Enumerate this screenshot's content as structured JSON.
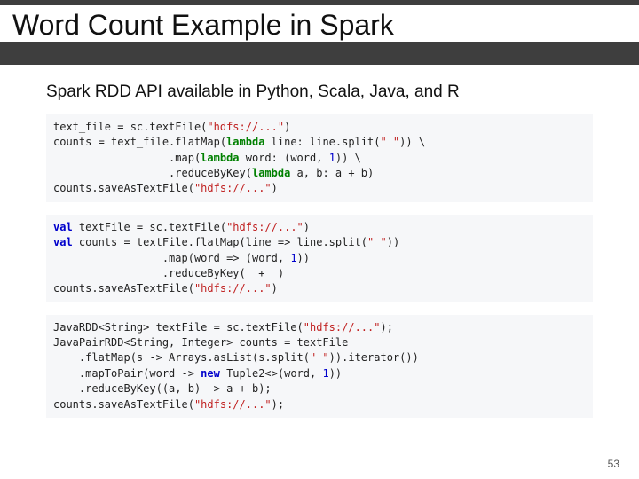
{
  "header": {
    "title": "Word Count Example in Spark"
  },
  "subtitle": "Spark RDD API available in Python, Scala, Java, and R",
  "code": {
    "python": {
      "l1a": "text_file = sc.textFile(",
      "l1b": "\"hdfs://...\"",
      "l1c": ")",
      "l2a": "counts = text_file.flatMap(",
      "l2kw": "lambda",
      "l2b": " line: line.split(",
      "l2s": "\" \"",
      "l2c": ")) \\",
      "l3pad": "                  .map(",
      "l3kw": "lambda",
      "l3b": " word: (word, ",
      "l3n": "1",
      "l3c": ")) \\",
      "l4pad": "                  .reduceByKey(",
      "l4kw": "lambda",
      "l4b": " a, b: a + b)",
      "l5a": "counts.saveAsTextFile(",
      "l5s": "\"hdfs://...\"",
      "l5c": ")"
    },
    "scala": {
      "kw": "val",
      "l1a": " textFile = sc.textFile(",
      "l1s": "\"hdfs://...\"",
      "l1c": ")",
      "l2a": " counts = textFile.flatMap(line => line.split(",
      "l2s": "\" \"",
      "l2c": "))",
      "l3": "                 .map(word => (word, ",
      "l3n": "1",
      "l3c": "))",
      "l4": "                 .reduceByKey(_ + _)",
      "l5a": "counts.saveAsTextFile(",
      "l5s": "\"hdfs://...\"",
      "l5c": ")"
    },
    "java": {
      "l1a": "JavaRDD<String> textFile = sc.textFile(",
      "l1s": "\"hdfs://...\"",
      "l1c": ");",
      "l2": "JavaPairRDD<String, Integer> counts = textFile",
      "l3a": "    .flatMap(s -> Arrays.asList(s.split(",
      "l3s": "\" \"",
      "l3c": ")).iterator())",
      "l4a": "    .mapToPair(word -> ",
      "l4kw": "new",
      "l4b": " Tuple2<>(word, ",
      "l4n": "1",
      "l4c": "))",
      "l5": "    .reduceByKey((a, b) -> a + b);",
      "l6a": "counts.saveAsTextFile(",
      "l6s": "\"hdfs://...\"",
      "l6c": ");"
    }
  },
  "page_number": "53"
}
